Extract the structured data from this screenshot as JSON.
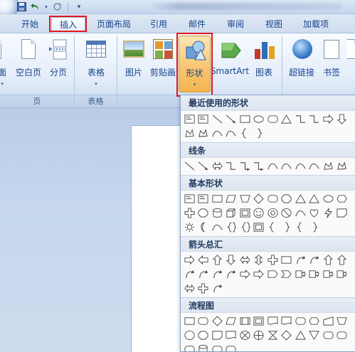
{
  "quick_access": {
    "icons": [
      "save-icon",
      "undo-icon",
      "redo-icon",
      "customize-icon"
    ]
  },
  "tabs": [
    {
      "label": "开始",
      "active": false
    },
    {
      "label": "插入",
      "active": true
    },
    {
      "label": "页面布局",
      "active": false
    },
    {
      "label": "引用",
      "active": false
    },
    {
      "label": "邮件",
      "active": false
    },
    {
      "label": "审阅",
      "active": false
    },
    {
      "label": "视图",
      "active": false
    },
    {
      "label": "加载项",
      "active": false
    }
  ],
  "ribbon": {
    "buttons": {
      "cover": "面",
      "blank_page": "空白页",
      "page_break": "分页",
      "table": "表格",
      "picture": "图片",
      "clipart": "剪贴画",
      "shapes": "形状",
      "smartart": "SmartArt",
      "chart": "图表",
      "hyperlink": "超链接",
      "bookmark": "书签"
    },
    "groups": {
      "pages": "页",
      "tables": "表格"
    }
  },
  "shapes_gallery": {
    "categories": [
      {
        "label": "最近使用的形状",
        "rows": [
          [
            "textbox",
            "vtextbox",
            "line",
            "arrow-line",
            "rect",
            "ellipse",
            "rounded-rect",
            "triangle",
            "elbow",
            "elbow2",
            "right-arrow",
            "down-arrow"
          ],
          [
            "freeform",
            "scribble",
            "curve",
            "curve2",
            "lbrace",
            "rbrace"
          ]
        ]
      },
      {
        "label": "线条",
        "rows": [
          [
            "line",
            "arrow-line",
            "dbl-arrow",
            "elbow",
            "elbow-arrow",
            "elbow-dbl",
            "curve-s",
            "curve-arrow",
            "curve-dbl",
            "curve",
            "freeform",
            "scribble"
          ]
        ]
      },
      {
        "label": "基本形状",
        "rows": [
          [
            "textbox",
            "vtextbox",
            "rect",
            "parallelogram",
            "trapezoid",
            "diamond",
            "rounded-rect",
            "octagon",
            "triangle",
            "right-triangle",
            "ellipse",
            "hexagon"
          ],
          [
            "cross",
            "pentagon",
            "can",
            "cube",
            "bevel",
            "smiley",
            "donut",
            "no-symbol",
            "arc",
            "heart",
            "lightning",
            "folded"
          ],
          [
            "sun",
            "moon",
            "arc2",
            "brackets",
            "braces",
            "plaque",
            "lbracket",
            "rbracket",
            "lbrace",
            "rbrace"
          ]
        ]
      },
      {
        "label": "箭头总汇",
        "rows": [
          [
            "right-arrow",
            "left-arrow",
            "up-arrow",
            "down-arrow",
            "lr-arrow",
            "ud-arrow",
            "quad-arrow",
            "lru-arrow",
            "bent-arrow",
            "uturn",
            "lup-arrow",
            "bentup"
          ],
          [
            "curved-right",
            "curved-left",
            "curved-up",
            "curved-down",
            "striped",
            "notched",
            "home-plate",
            "chevron",
            "right-callout",
            "down-callout",
            "left-callout",
            "up-callout"
          ],
          [
            "lr-callout",
            "quad-callout",
            "circular"
          ]
        ]
      },
      {
        "label": "流程图",
        "rows": [
          [
            "process",
            "alt-process",
            "decision",
            "data",
            "predefined",
            "internal",
            "document",
            "multidoc",
            "terminator",
            "preparation",
            "manual-input",
            "manual-op"
          ],
          [
            "connector",
            "offpage",
            "card",
            "punched-tape",
            "summing",
            "or",
            "collate",
            "sort",
            "extract",
            "merge",
            "stored-data",
            "delay"
          ],
          [
            "seq-storage",
            "magnetic-disk",
            "direct-storage",
            "display"
          ]
        ]
      }
    ]
  }
}
